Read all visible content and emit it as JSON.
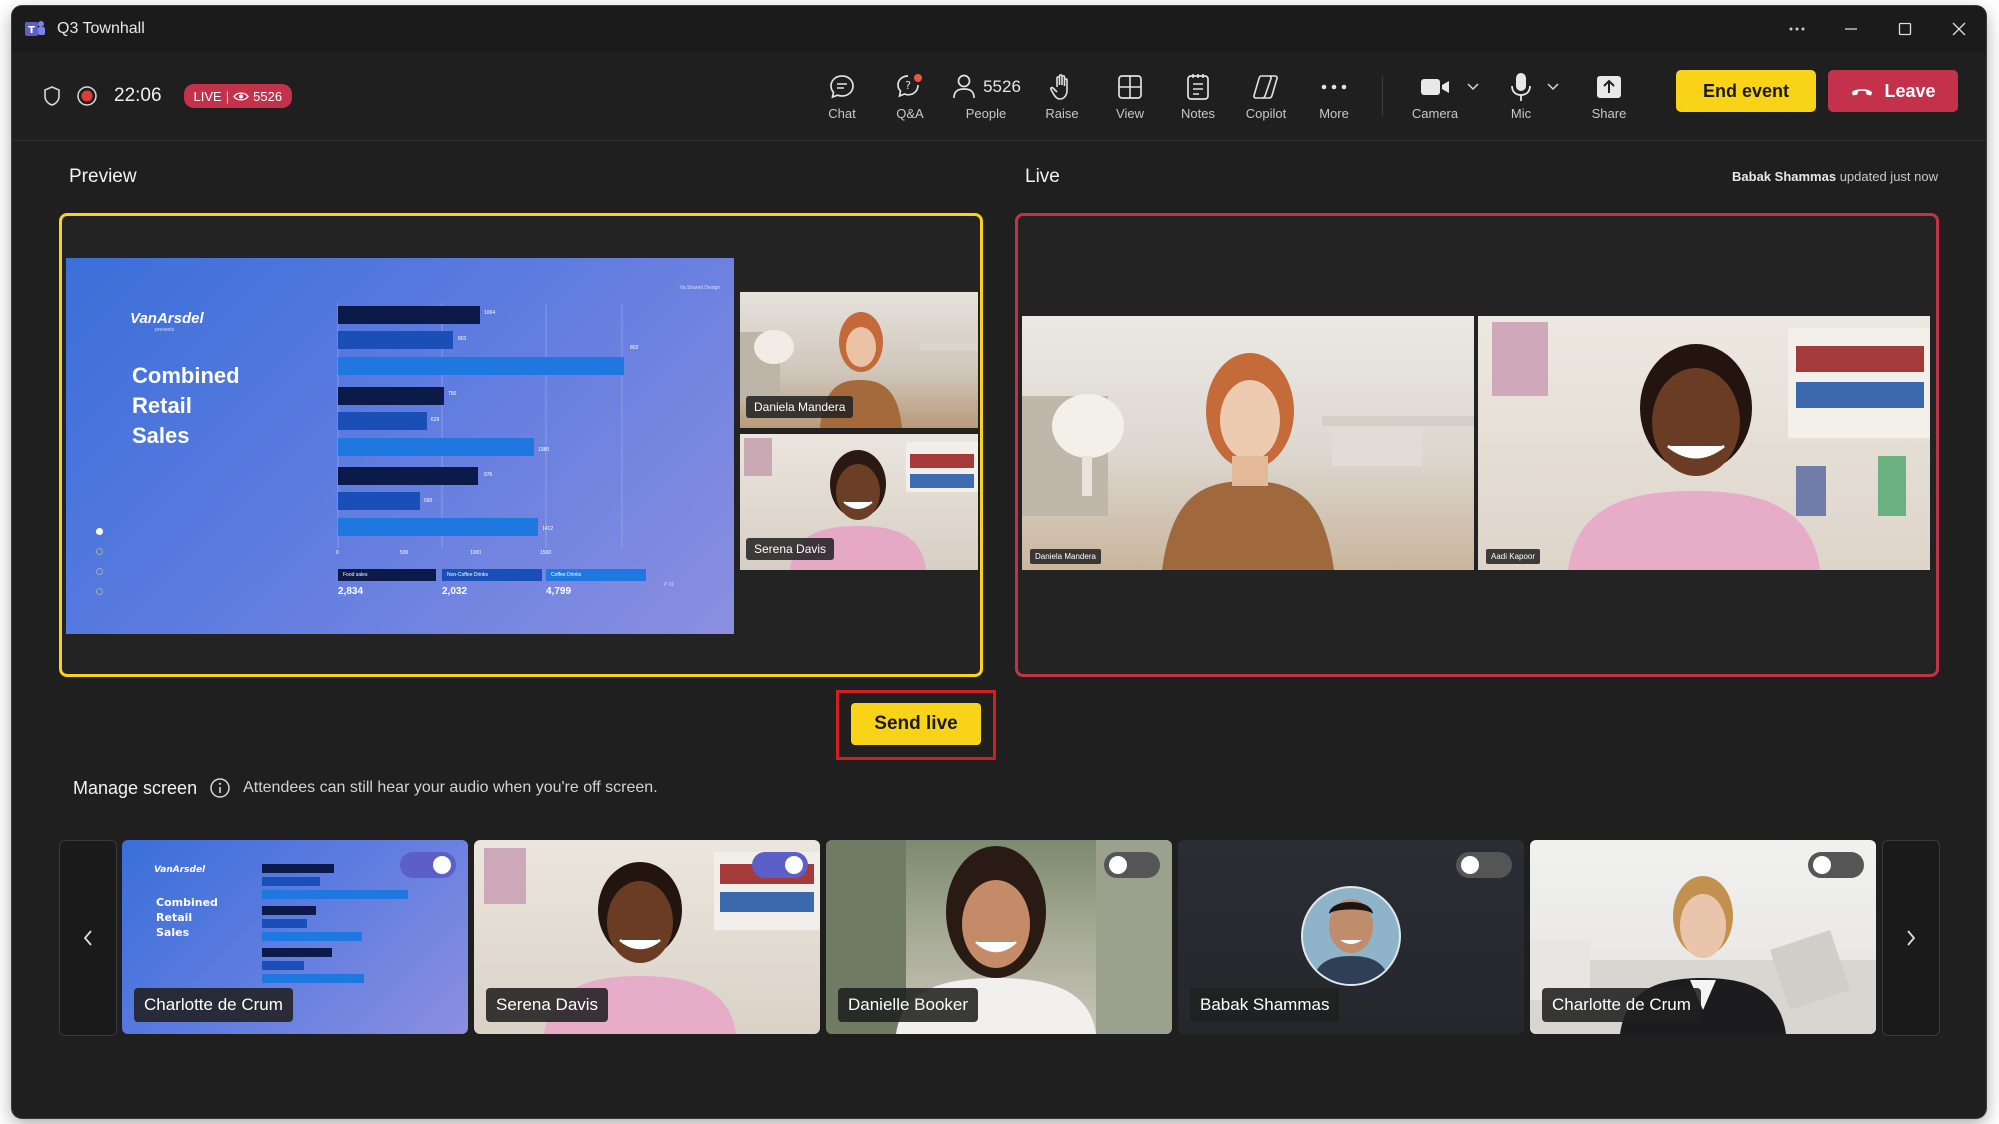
{
  "window": {
    "title": "Q3 Townhall"
  },
  "header": {
    "timer": "22:06",
    "live_label": "LIVE",
    "viewer_count": "5526"
  },
  "toolbar": {
    "items": [
      {
        "label": "Chat",
        "icon": "chat-icon"
      },
      {
        "label": "Q&A",
        "icon": "qa-icon"
      },
      {
        "label": "People",
        "icon": "people-icon",
        "count": "5526"
      },
      {
        "label": "Raise",
        "icon": "hand-icon"
      },
      {
        "label": "View",
        "icon": "grid-icon"
      },
      {
        "label": "Notes",
        "icon": "notes-icon"
      },
      {
        "label": "Copilot",
        "icon": "copilot-icon"
      },
      {
        "label": "More",
        "icon": "more-icon"
      },
      {
        "label": "Camera",
        "icon": "camera-icon"
      },
      {
        "label": "Mic",
        "icon": "mic-icon"
      },
      {
        "label": "Share",
        "icon": "share-icon"
      }
    ],
    "end_event": "End event",
    "leave": "Leave"
  },
  "preview": {
    "title": "Preview",
    "slide": {
      "brand": "VanArsdel",
      "brand_sub": "presents",
      "title_lines": [
        "Combined",
        "Retail",
        "Sales"
      ],
      "corner": "Va Shared Design",
      "legend": [
        {
          "label": "Food sales",
          "value": "2,834",
          "color": "#0c1a4a"
        },
        {
          "label": "Non-Coffee Drinks",
          "value": "2,032",
          "color": "#1a4fb8"
        },
        {
          "label": "Coffee Drinks",
          "value": "4,799",
          "color": "#1f77e0"
        }
      ],
      "bar_labels": [
        "1004",
        "803",
        "803",
        "750",
        "629",
        "1380",
        "976",
        "590",
        "1412"
      ],
      "axis_ticks": [
        "0",
        "500",
        "1000",
        "1500"
      ],
      "page": "P 01"
    },
    "tiles": [
      {
        "name": "Daniela Mandera"
      },
      {
        "name": "Serena Davis"
      }
    ]
  },
  "live": {
    "title": "Live",
    "updated_by": "Babak Shammas",
    "updated_text": "updated just now",
    "tiles": [
      {
        "name": "Daniela Mandera"
      },
      {
        "name": "Aadi Kapoor"
      }
    ]
  },
  "send_live": "Send live",
  "manage": {
    "title": "Manage screen",
    "note": "Attendees can still hear your audio when you're off screen.",
    "tiles": [
      {
        "name": "Charlotte de Crum",
        "on_screen": true
      },
      {
        "name": "Serena Davis",
        "on_screen": true
      },
      {
        "name": "Danielle Booker",
        "on_screen": false
      },
      {
        "name": "Babak Shammas",
        "on_screen": false
      },
      {
        "name": "Charlotte de Crum",
        "on_screen": false
      }
    ]
  },
  "colors": {
    "accent_yellow": "#f8d317",
    "live_red": "#c4314b",
    "toggle_on": "#5b5fc7"
  }
}
